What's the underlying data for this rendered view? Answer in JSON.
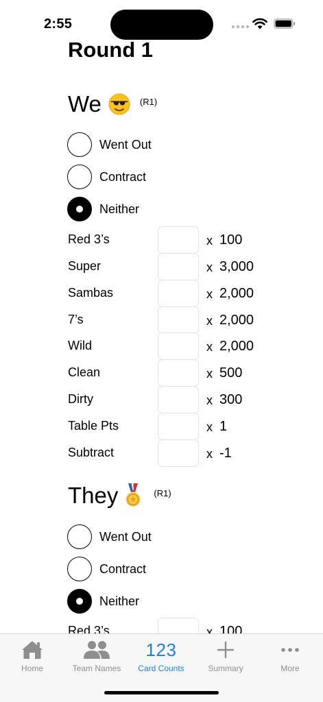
{
  "status_bar": {
    "time": "2:55"
  },
  "page": {
    "title": "Round 1"
  },
  "teams": [
    {
      "name": "We",
      "emoji": "sunglasses-face-icon",
      "tag": "(R1)",
      "options": [
        {
          "label": "Went Out",
          "selected": false
        },
        {
          "label": "Contract",
          "selected": false
        },
        {
          "label": "Neither",
          "selected": true
        }
      ],
      "fields": [
        {
          "label": "Red 3’s",
          "value": "",
          "x": "x",
          "multiplier": "100"
        },
        {
          "label": "Super",
          "value": "",
          "x": "x",
          "multiplier": "3,000"
        },
        {
          "label": "Sambas",
          "value": "",
          "x": "x",
          "multiplier": "2,000"
        },
        {
          "label": "7’s",
          "value": "",
          "x": "x",
          "multiplier": "2,000"
        },
        {
          "label": "Wild",
          "value": "",
          "x": "x",
          "multiplier": "2,000"
        },
        {
          "label": "Clean",
          "value": "",
          "x": "x",
          "multiplier": "500"
        },
        {
          "label": "Dirty",
          "value": "",
          "x": "x",
          "multiplier": "300"
        },
        {
          "label": "Table Pts",
          "value": "",
          "x": "x",
          "multiplier": "1"
        },
        {
          "label": "Subtract",
          "value": "",
          "x": "x",
          "multiplier": "-1"
        }
      ]
    },
    {
      "name": "They",
      "emoji": "gold-medal-icon",
      "tag": "(R1)",
      "options": [
        {
          "label": "Went Out",
          "selected": false
        },
        {
          "label": "Contract",
          "selected": false
        },
        {
          "label": "Neither",
          "selected": true
        }
      ],
      "fields": [
        {
          "label": "Red 3’s",
          "value": "",
          "x": "x",
          "multiplier": "100"
        }
      ]
    }
  ],
  "tab_bar": {
    "tabs": [
      {
        "label": "Home",
        "icon": "house-icon",
        "active": false
      },
      {
        "label": "Team Names",
        "icon": "people-icon",
        "active": false
      },
      {
        "label": "Card Counts",
        "icon": "123",
        "active": true
      },
      {
        "label": "Summary",
        "icon": "plus-icon",
        "active": false
      },
      {
        "label": "More",
        "icon": "ellipsis-icon",
        "active": false
      }
    ]
  },
  "colors": {
    "accent": "#1a7ff1",
    "inactive_tab": "#8e8e8e",
    "tab_bar_bg": "#f7f7f7"
  }
}
